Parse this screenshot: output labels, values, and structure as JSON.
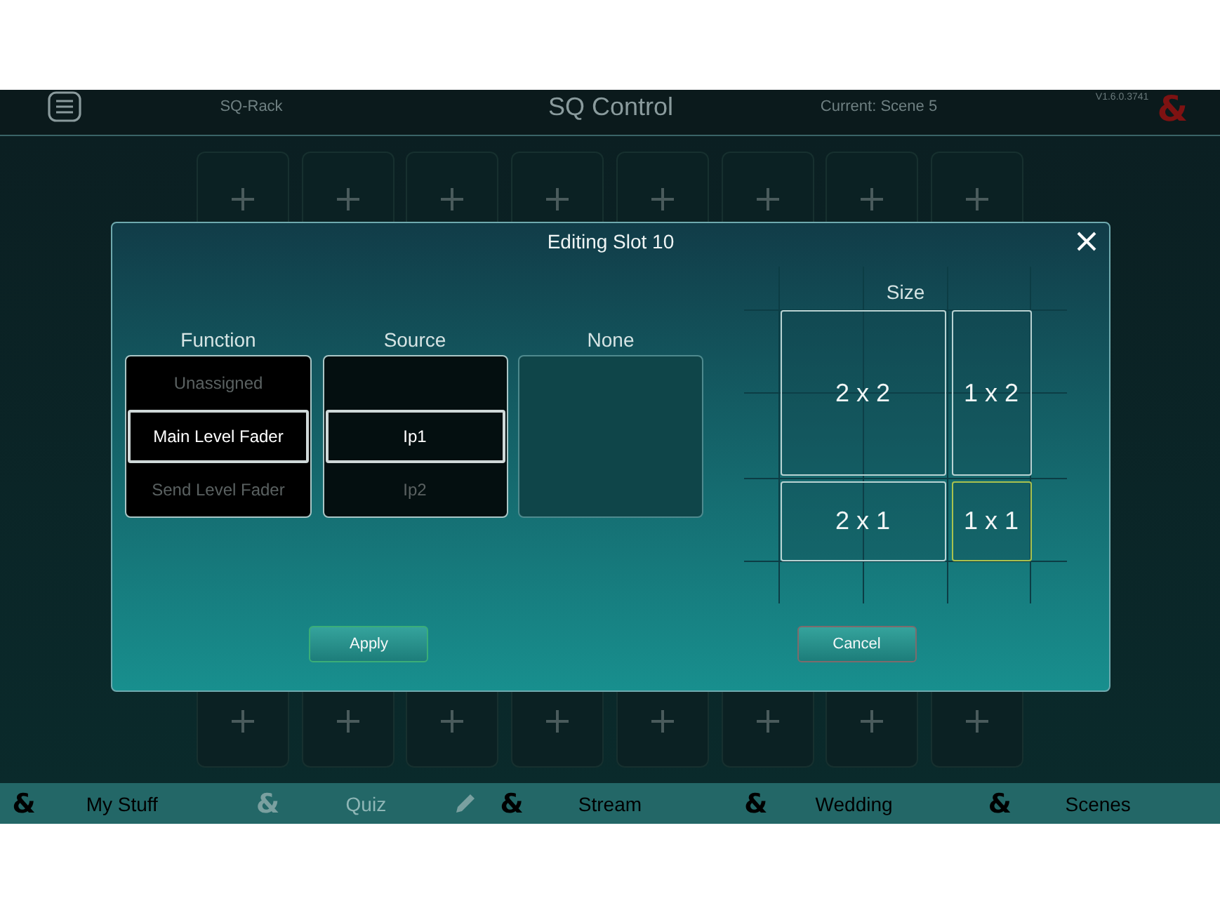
{
  "header": {
    "device": "SQ-Rack",
    "title": "SQ Control",
    "current_scene": "Current: Scene 5",
    "version": "V1.6.0.3741",
    "logo": "&"
  },
  "slot_grid": {
    "top_row": [
      {
        "kind": "empty"
      },
      {
        "kind": "empty"
      },
      {
        "kind": "empty"
      },
      {
        "kind": "empty"
      },
      {
        "kind": "empty"
      },
      {
        "kind": "empty"
      },
      {
        "kind": "empty"
      },
      {
        "kind": "empty"
      }
    ],
    "bottom_row": [
      {
        "kind": "empty"
      },
      {
        "kind": "empty"
      },
      {
        "kind": "empty"
      },
      {
        "kind": "empty"
      },
      {
        "kind": "empty"
      },
      {
        "kind": "empty"
      },
      {
        "kind": "empty"
      },
      {
        "kind": "empty"
      }
    ]
  },
  "dialog": {
    "title": "Editing Slot 10",
    "pickers": [
      {
        "heading": "Function",
        "items": [
          {
            "label": "Unassigned",
            "selected": false
          },
          {
            "label": "Main Level Fader",
            "selected": true
          },
          {
            "label": "Send Level Fader",
            "selected": false
          }
        ]
      },
      {
        "heading": "Source",
        "items": [
          {
            "label": "Ip1",
            "selected": true
          },
          {
            "label": "Ip2",
            "selected": false
          }
        ]
      },
      {
        "heading": "None"
      }
    ],
    "size": {
      "heading": "Size",
      "options": [
        {
          "label": "2 x 2",
          "kind": "large",
          "selected": false
        },
        {
          "label": "1 x 2",
          "kind": "tall",
          "selected": false
        },
        {
          "label": "2 x 1",
          "kind": "wide",
          "selected": false
        },
        {
          "label": "1 x 1",
          "kind": "small",
          "selected": true
        }
      ]
    },
    "buttons": [
      {
        "label": "Apply",
        "kind": "confirm"
      },
      {
        "label": "Cancel",
        "kind": "cancel"
      }
    ]
  },
  "tabs": [
    {
      "icon": "&",
      "label": "My Stuff",
      "selected": false
    },
    {
      "icon": "&",
      "label": "Quiz",
      "selected": true
    },
    {
      "icon": "&",
      "label": "Stream",
      "selected": false
    },
    {
      "icon": "&",
      "label": "Wedding",
      "selected": false
    },
    {
      "icon": "&",
      "label": "Scenes",
      "selected": false
    }
  ]
}
